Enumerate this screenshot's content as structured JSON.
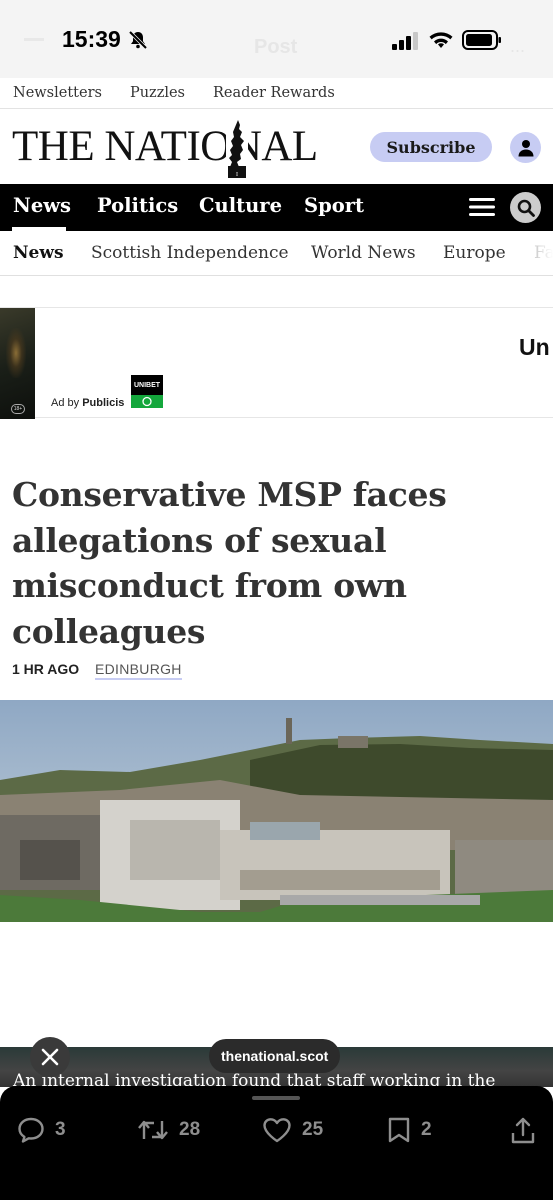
{
  "status_bar": {
    "time": "15:39",
    "app_title": "Post",
    "more": "..."
  },
  "utility_nav": [
    "Newsletters",
    "Puzzles",
    "Reader Rewards"
  ],
  "masthead": {
    "logo": "THE NATIONAL",
    "subscribe_label": "Subscribe"
  },
  "main_nav": [
    "News",
    "Politics",
    "Culture",
    "Sport"
  ],
  "sub_nav": [
    "News",
    "Scottish Independence",
    "World News",
    "Europe",
    "Fa"
  ],
  "ad": {
    "by_label": "Ad by",
    "by_brand": "Publicis",
    "sponsor": "UNIBET",
    "headline_partial": "Un",
    "age_badge": "18+"
  },
  "article": {
    "headline": "Conservative MSP faces allegations of sexual misconduct from own colleagues",
    "time": "1 HR AGO",
    "location": "EDINBURGH",
    "caption": "An internal investigation found that staff working in the"
  },
  "overlay": {
    "url": "thenational.scot"
  },
  "actions": {
    "replies": "3",
    "reposts": "28",
    "likes": "25",
    "bookmarks": "2"
  },
  "colors": {
    "accent": "#c7ccf3",
    "nav_bg": "#000000"
  }
}
